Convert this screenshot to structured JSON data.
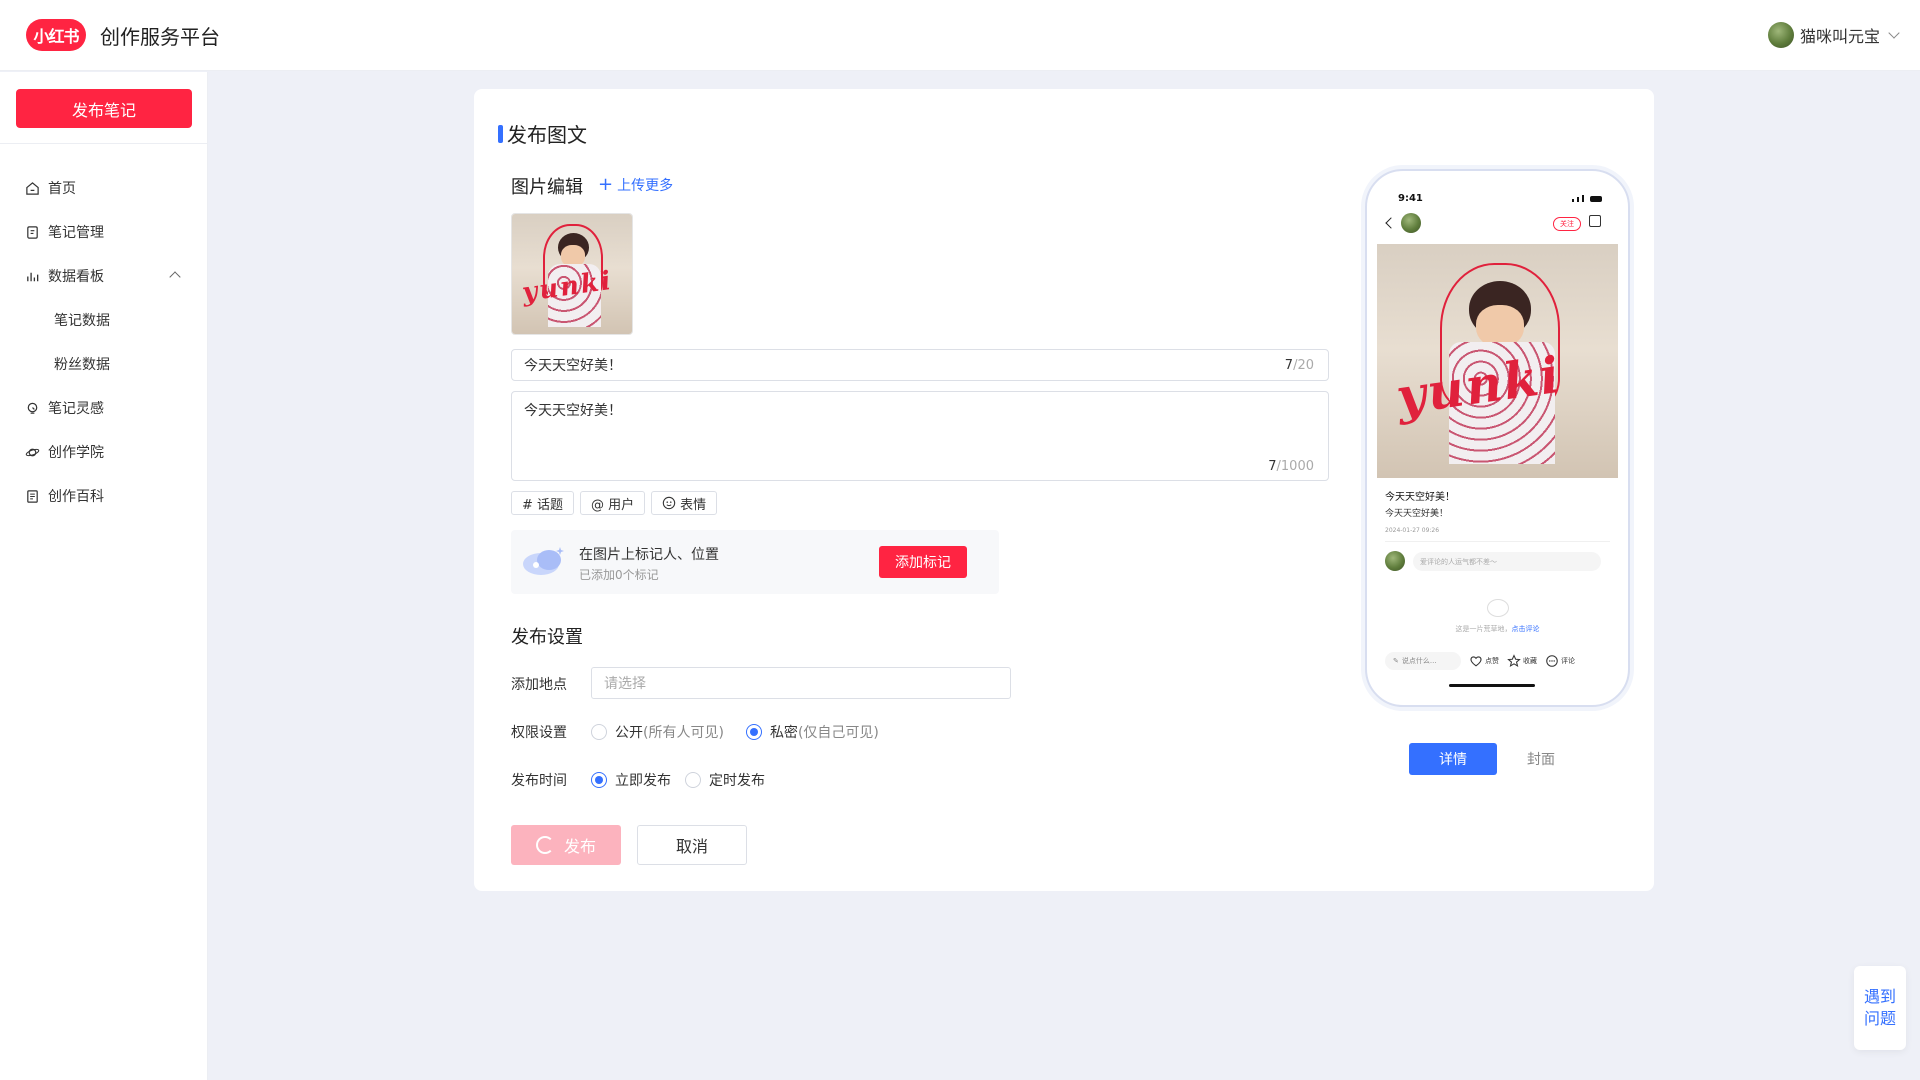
{
  "header": {
    "logo_text": "小红书",
    "platform_title": "创作服务平台",
    "user_name": "猫咪叫元宝"
  },
  "sidebar": {
    "publish_button": "发布笔记",
    "items": [
      {
        "label": "首页",
        "icon": "home-icon"
      },
      {
        "label": "笔记管理",
        "icon": "note-icon"
      },
      {
        "label": "数据看板",
        "icon": "bar-chart-icon",
        "expanded": true
      },
      {
        "label": "笔记数据",
        "sub": true
      },
      {
        "label": "粉丝数据",
        "sub": true
      },
      {
        "label": "笔记灵感",
        "icon": "lightbulb-icon"
      },
      {
        "label": "创作学院",
        "icon": "planet-icon"
      },
      {
        "label": "创作百科",
        "icon": "book-icon"
      }
    ]
  },
  "editor": {
    "page_title": "发布图文",
    "image_section_title": "图片编辑",
    "upload_more": "上传更多",
    "image_scribble_text": "yunki",
    "title_value": "今天天空好美！",
    "title_count": "7",
    "title_max": "/20",
    "body_value": "今天天空好美！",
    "body_count": "7",
    "body_max": "/1000",
    "tag_buttons": [
      "# 话题",
      "@ 用户",
      "表情"
    ],
    "mark": {
      "title": "在图片上标记人、位置",
      "subtitle": "已添加0个标记",
      "button": "添加标记"
    }
  },
  "settings": {
    "section_title": "发布设置",
    "location_label": "添加地点",
    "location_placeholder": "请选择",
    "permission_label": "权限设置",
    "permission_options": [
      {
        "label": "公开",
        "hint": "(所有人可见)",
        "selected": false
      },
      {
        "label": "私密",
        "hint": "(仅自己可见)",
        "selected": true
      }
    ],
    "time_label": "发布时间",
    "time_options": [
      {
        "label": "立即发布",
        "selected": true
      },
      {
        "label": "定时发布",
        "selected": false
      }
    ],
    "publish_button": "发布",
    "cancel_button": "取消"
  },
  "preview": {
    "status_time": "9:41",
    "follow": "关注",
    "title": "今天天空好美！",
    "body": "今天天空好美！",
    "date": "2024-01-27 09:26",
    "comment_placeholder": "爱评论的人运气都不差～",
    "empty_text": "这是一片荒草地，",
    "empty_link": "点击评论",
    "say_placeholder": "说点什么...",
    "actions": [
      "点赞",
      "收藏",
      "评论"
    ],
    "tabs": [
      "详情",
      "封面"
    ],
    "active_tab": "详情"
  },
  "help": {
    "label": "遇到问题"
  },
  "colors": {
    "brand_red": "#ff2442",
    "accent_blue": "#3470ff",
    "page_bg": "#eef0f7"
  }
}
